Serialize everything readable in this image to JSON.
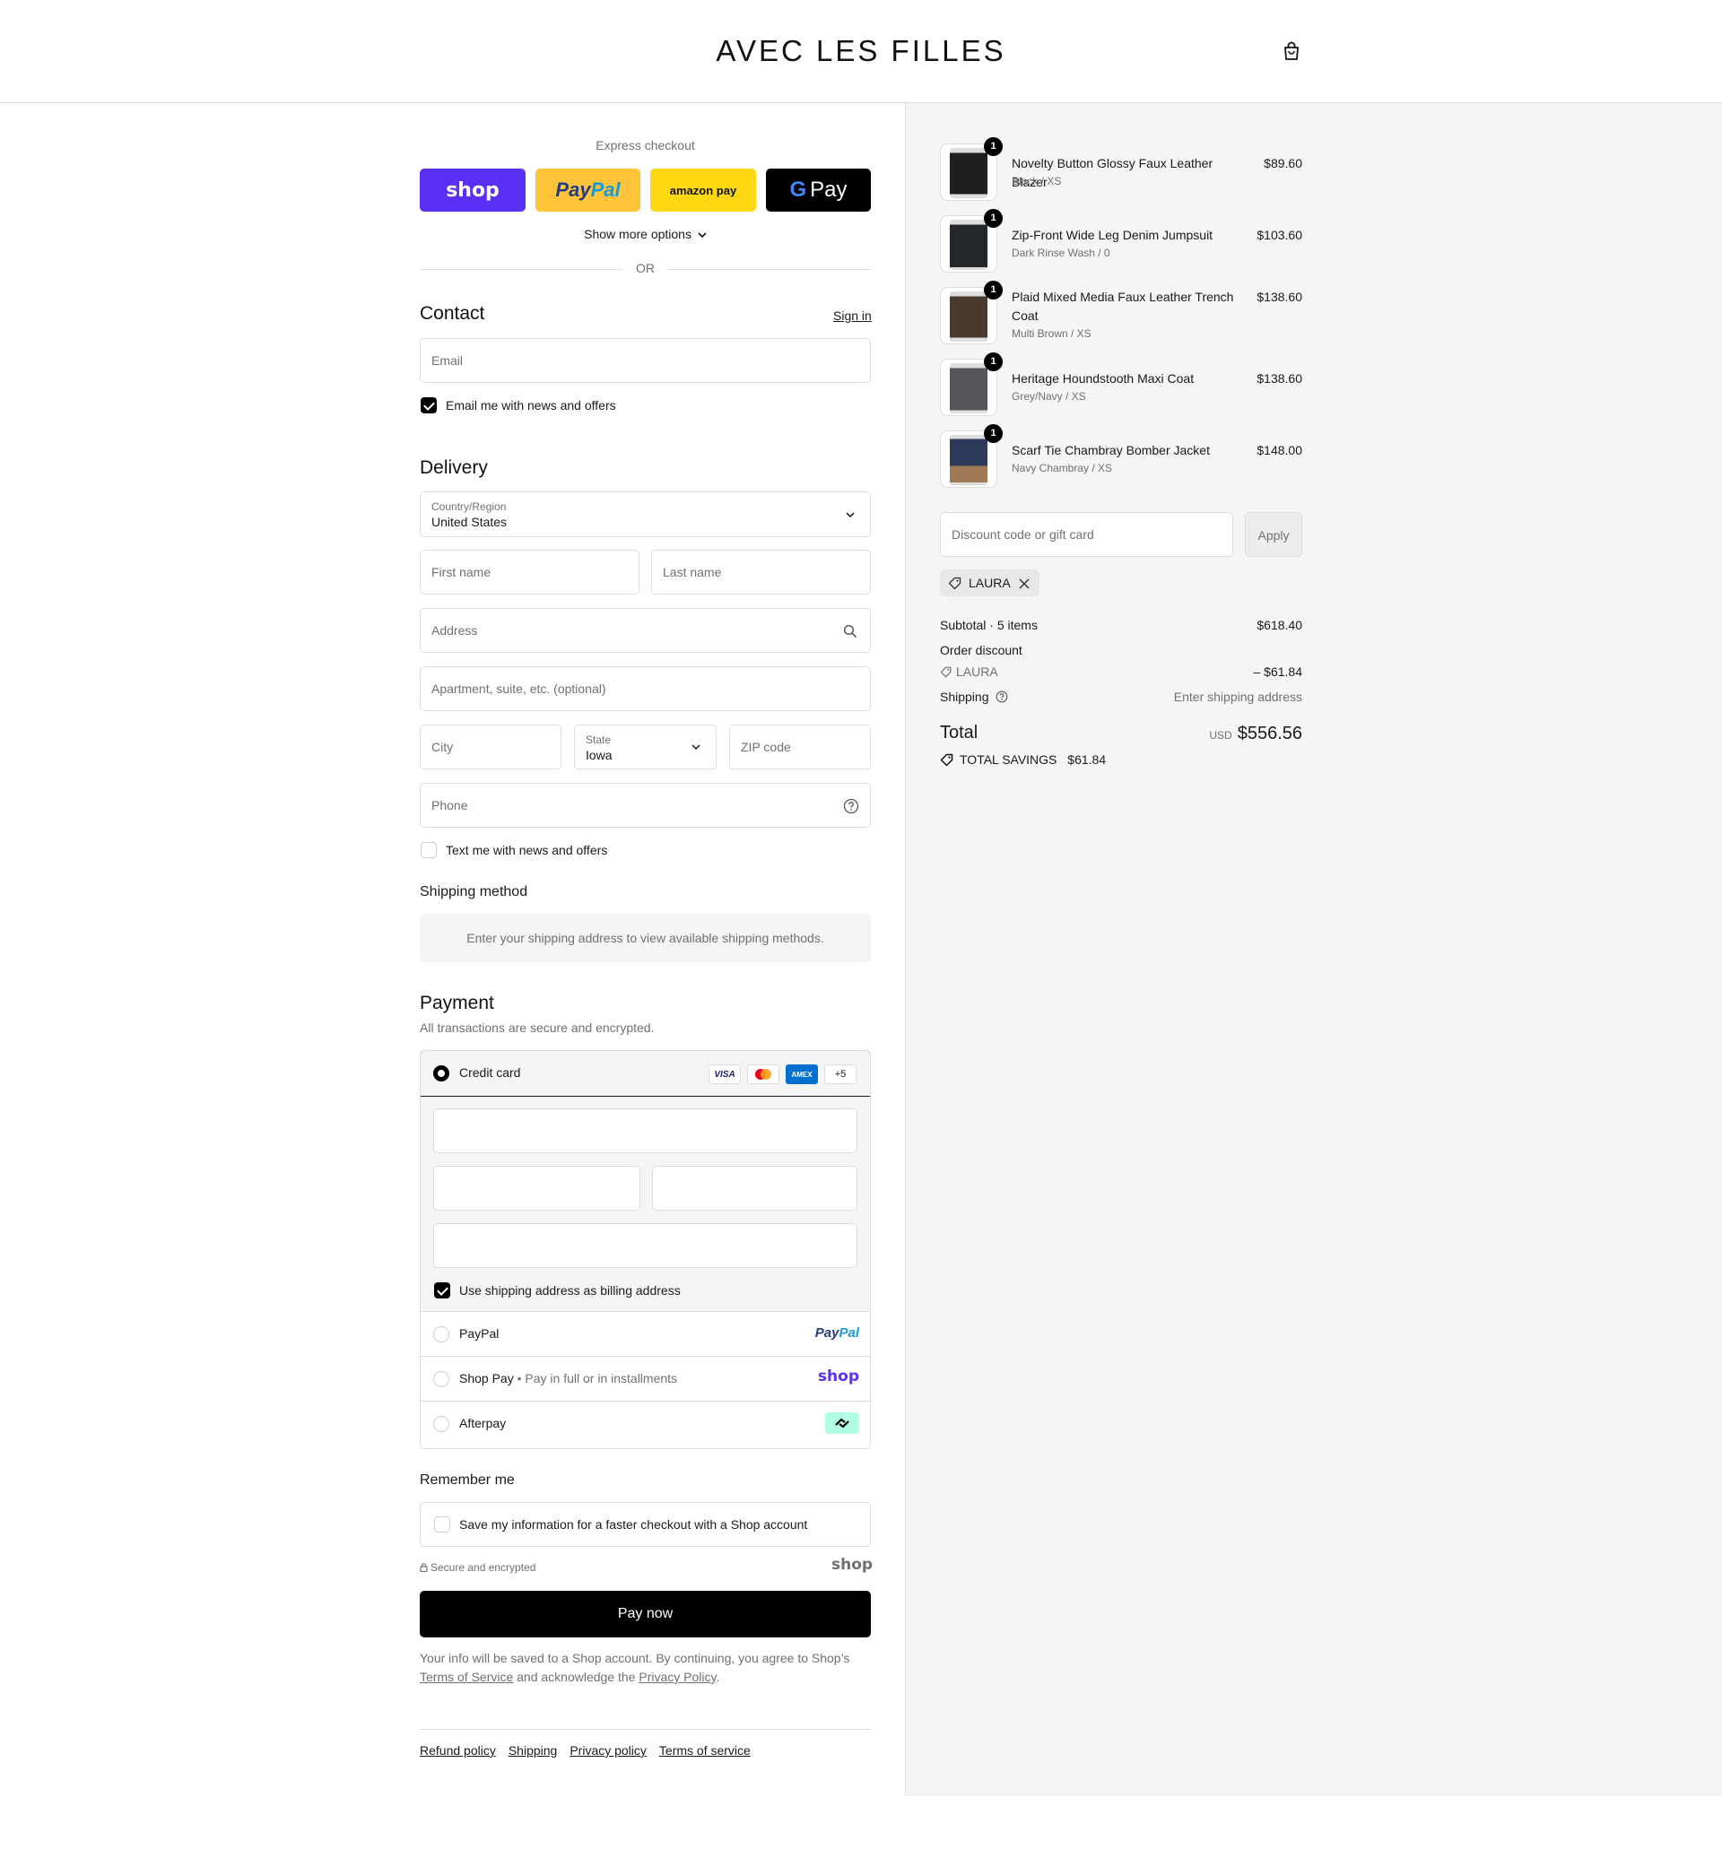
{
  "header": {
    "logo": "AVEC LES FILLES",
    "cart_icon": "bag-icon"
  },
  "express": {
    "title": "Express checkout",
    "buttons": {
      "shop": "shop",
      "paypal_1": "Pay",
      "paypal_2": "Pal",
      "amazon": "amazon pay",
      "gpay": "Pay"
    },
    "more_options": "Show more options",
    "or": "OR"
  },
  "contact": {
    "heading": "Contact",
    "sign_in": "Sign in",
    "email_placeholder": "Email",
    "email_news_label": "Email me with news and offers",
    "email_news_checked": true
  },
  "delivery": {
    "heading": "Delivery",
    "country_label": "Country/Region",
    "country_value": "United States",
    "first_name_placeholder": "First name",
    "last_name_placeholder": "Last name",
    "address_placeholder": "Address",
    "apartment_placeholder": "Apartment, suite, etc. (optional)",
    "city_placeholder": "City",
    "state_label": "State",
    "state_value": "Iowa",
    "zip_placeholder": "ZIP code",
    "phone_placeholder": "Phone",
    "text_news_label": "Text me with news and offers",
    "text_news_checked": false
  },
  "shipping_method": {
    "heading": "Shipping method",
    "info": "Enter your shipping address to view available shipping methods."
  },
  "payment": {
    "heading": "Payment",
    "subtitle": "All transactions are secure and encrypted.",
    "credit_card_label": "Credit card",
    "cards": {
      "visa": "VISA",
      "amex": "AMEX",
      "more": "+5"
    },
    "billing_label": "Use shipping address as billing address",
    "paypal_label": "PayPal",
    "paypal_logo_1": "Pay",
    "paypal_logo_2": "Pal",
    "shoppay_label": "Shop Pay",
    "shoppay_sub": "Pay in full or in installments",
    "shoppay_logo": "shop",
    "afterpay_label": "Afterpay",
    "afterpay_icon": "afterpay-icon"
  },
  "remember": {
    "heading": "Remember me",
    "save_label": "Save my information for a faster checkout with a Shop account",
    "secure_label": "Secure and encrypted",
    "shop_logo": "shop"
  },
  "pay_now": "Pay now",
  "legal": {
    "part1": "Your info will be saved to a Shop account. By continuing, you agree to Shop’s ",
    "terms": "Terms of Service",
    "part2": " and acknowledge the ",
    "privacy": "Privacy Policy",
    "part3": "."
  },
  "footer_links": [
    "Refund policy",
    "Shipping",
    "Privacy policy",
    "Terms of service"
  ],
  "cart": {
    "items": [
      {
        "name": "Novelty Button Glossy Faux Leather Blazer",
        "variant": "Black / XS",
        "price": "$89.60",
        "qty": "1",
        "color": "#1f1f1f"
      },
      {
        "name": "Zip-Front Wide Leg Denim Jumpsuit",
        "variant": "Dark Rinse Wash / 0",
        "price": "$103.60",
        "qty": "1",
        "color": "#23262b"
      },
      {
        "name": "Plaid Mixed Media Faux Leather Trench Coat",
        "variant": "Multi Brown / XS",
        "price": "$138.60",
        "qty": "1",
        "color": "#4a3a2e"
      },
      {
        "name": "Heritage Houndstooth Maxi Coat",
        "variant": "Grey/Navy / XS",
        "price": "$138.60",
        "qty": "1",
        "color": "#55555c"
      },
      {
        "name": "Scarf Tie Chambray Bomber Jacket",
        "variant": "Navy Chambray / XS",
        "price": "$148.00",
        "qty": "1",
        "color": "#2e3a5c"
      }
    ],
    "discount_placeholder": "Discount code or gift card",
    "apply_label": "Apply",
    "applied_code": "LAURA",
    "subtotal_label": "Subtotal · 5 items",
    "subtotal_value": "$618.40",
    "order_discount_label": "Order discount",
    "discount_code": "LAURA",
    "discount_value": "– $61.84",
    "shipping_label": "Shipping",
    "shipping_value": "Enter shipping address",
    "total_label": "Total",
    "total_currency": "USD",
    "total_value": "$556.56",
    "savings_label": "TOTAL SAVINGS",
    "savings_value": "$61.84"
  },
  "colors": {
    "shop_purple": "#5a31f4",
    "paypal_yellow": "#ffc439",
    "amazon_yellow": "#ffd814",
    "afterpay_mint": "#b2fce4"
  }
}
